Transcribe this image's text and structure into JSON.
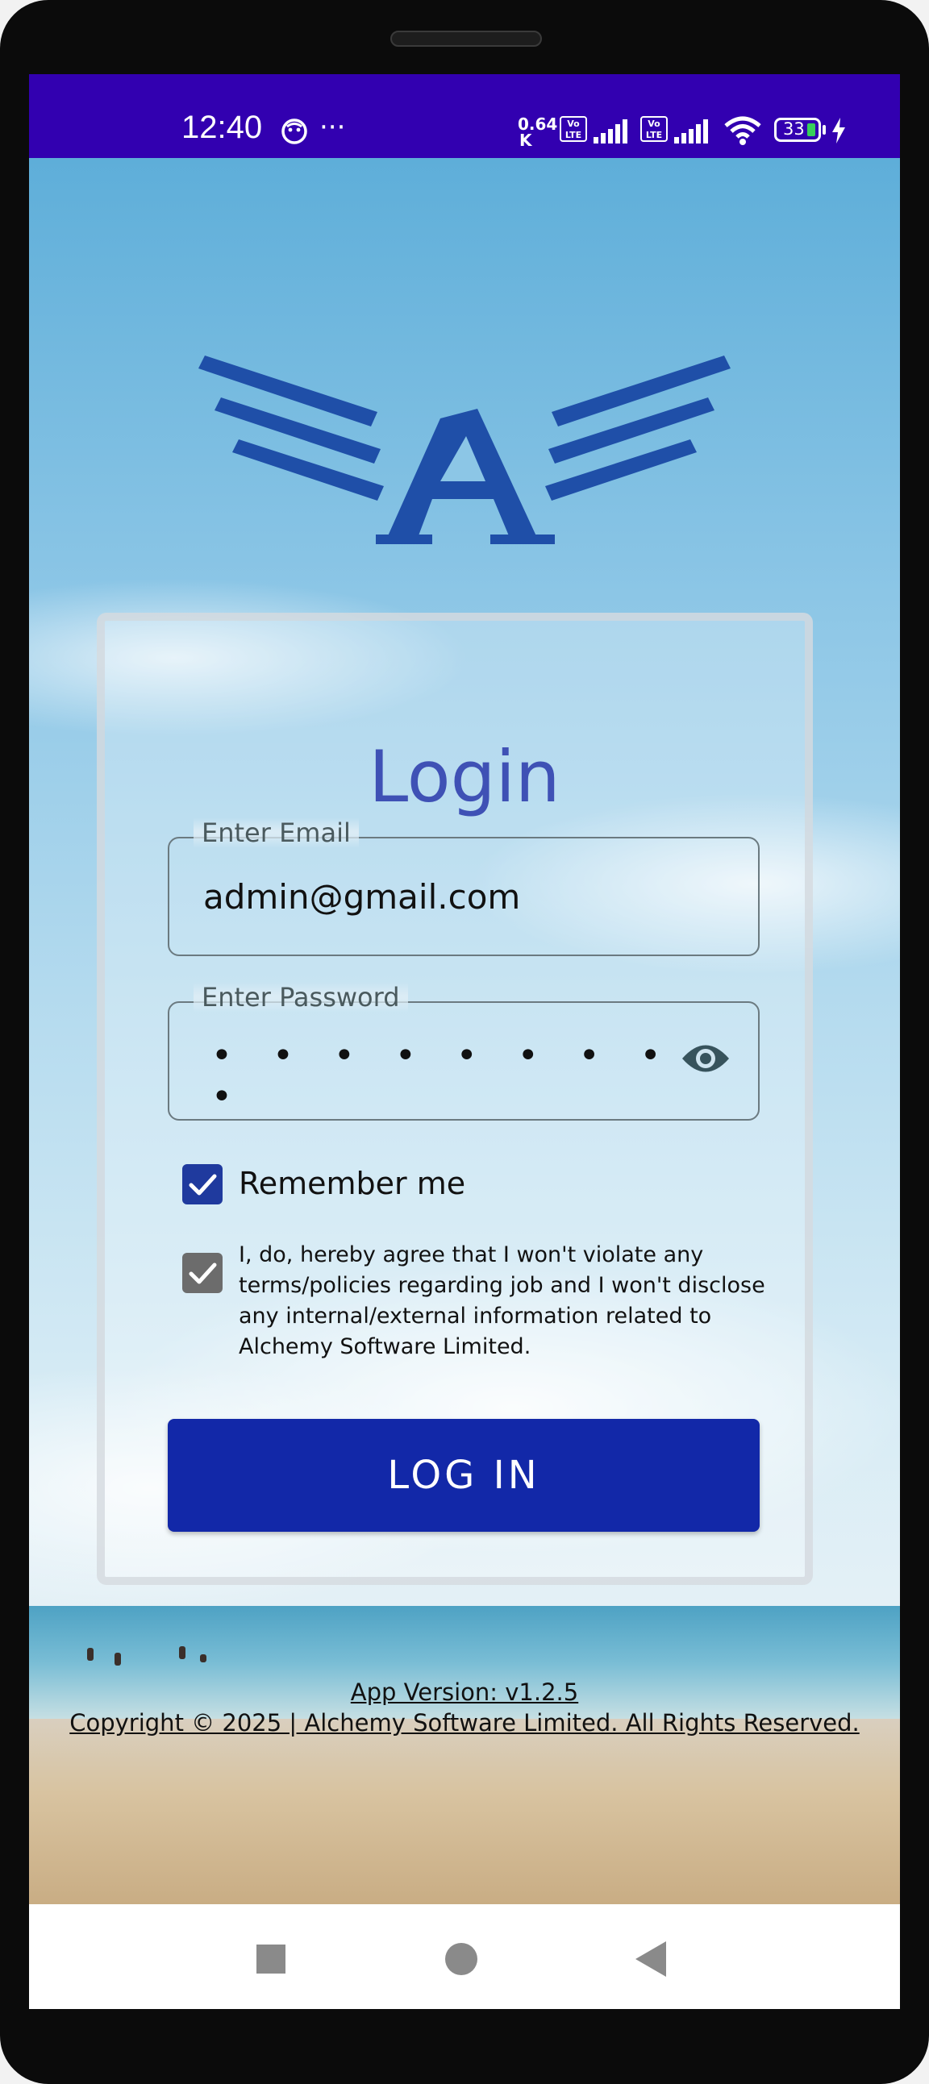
{
  "status_bar": {
    "time": "12:40",
    "more_dots": "···",
    "net_speed_value": "0.64",
    "net_speed_unit": "K",
    "volte_1": "Vo LTE",
    "volte_2": "Vo LTE",
    "battery": "33"
  },
  "login": {
    "title": "Login",
    "email_label": "Enter Email",
    "email_value": "admin@gmail.com",
    "password_label": "Enter Password",
    "password_masked": "• • • • • • • • • •",
    "remember_label": "Remember me",
    "remember_checked": true,
    "agreement_checked": true,
    "agreement_lines": [
      "I, do, hereby agree that I won't violate any",
      "terms/policies regarding job and I won't disclose",
      "any internal/external information related to",
      "Alchemy Software Limited."
    ],
    "login_button": "LOG IN"
  },
  "footer": {
    "version": "App Version: v1.2.5",
    "copyright": "Copyright © 2025 | Alchemy Software Limited. All Rights Reserved."
  },
  "colors": {
    "status_bar": "#3200b0",
    "title": "#3f51b5",
    "button": "#1228a8",
    "logo": "#1f4fa8",
    "checkbox_checked": "#1f3a9e",
    "checkbox_disabled": "#6c6c6c"
  },
  "icons": [
    "face-icon",
    "volte-icon",
    "signal-icon",
    "wifi-icon",
    "battery-icon",
    "charging-icon",
    "eye-icon",
    "check-icon",
    "recents-icon",
    "home-icon",
    "back-icon"
  ]
}
